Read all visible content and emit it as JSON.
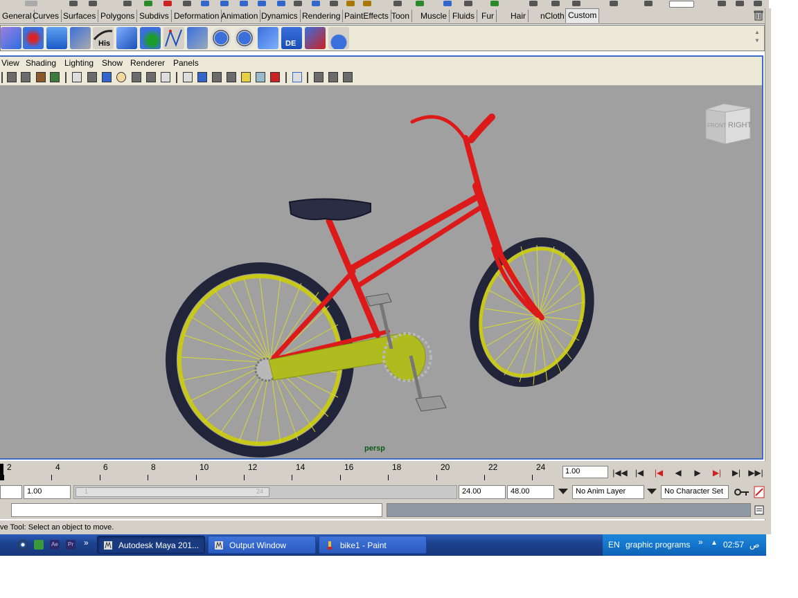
{
  "shelf_tabs": [
    {
      "label": "General"
    },
    {
      "label": "Curves"
    },
    {
      "label": "Surfaces"
    },
    {
      "label": "Polygons"
    },
    {
      "label": "Subdivs"
    },
    {
      "label": "Deformation"
    },
    {
      "label": "Animation"
    },
    {
      "label": "Dynamics"
    },
    {
      "label": "Rendering"
    },
    {
      "label": "PaintEffects"
    },
    {
      "label": "Toon"
    },
    {
      "label": "Muscle"
    },
    {
      "label": "Fluids"
    },
    {
      "label": "Fur"
    },
    {
      "label": "Hair"
    },
    {
      "label": "nCloth"
    },
    {
      "label": "Custom"
    }
  ],
  "shelf_icons": {
    "history_label": "His",
    "de_label": "DE"
  },
  "panel_menu": [
    {
      "label": "View"
    },
    {
      "label": "Shading"
    },
    {
      "label": "Lighting"
    },
    {
      "label": "Show"
    },
    {
      "label": "Renderer"
    },
    {
      "label": "Panels"
    }
  ],
  "viewport": {
    "camera_label": "persp",
    "view_cube_faces": {
      "front": "FRONT",
      "right": "RIGHT"
    },
    "colors": {
      "background": "#a0a0a0",
      "frame": "#dd1a1a",
      "tire": "#22253a",
      "rim": "#c8c818",
      "chain_guard": "#b0bb20",
      "seat": "#2a2d44"
    }
  },
  "time_slider": {
    "labels": [
      "2",
      "4",
      "6",
      "8",
      "10",
      "12",
      "14",
      "16",
      "18",
      "20",
      "22",
      "24"
    ],
    "current_frame": "1.00"
  },
  "range_slider": {
    "start_field": "1.00",
    "inner_start": "1",
    "inner_end": "24",
    "end_field": "24.00",
    "max_field": "48.00",
    "anim_layer": "No Anim Layer",
    "character_set": "No Character Set"
  },
  "help_line": {
    "text": "ve Tool: Select an object to move."
  },
  "taskbar": {
    "chevron": "»",
    "windows": [
      {
        "label": "Autodesk Maya 201..."
      },
      {
        "label": "Output Window"
      },
      {
        "label": "bike1 - Paint"
      }
    ],
    "tray": {
      "language": "EN",
      "toolbar_name": "graphic programs",
      "chevron": "»",
      "time": "02:57",
      "am_pm": "ص"
    }
  }
}
